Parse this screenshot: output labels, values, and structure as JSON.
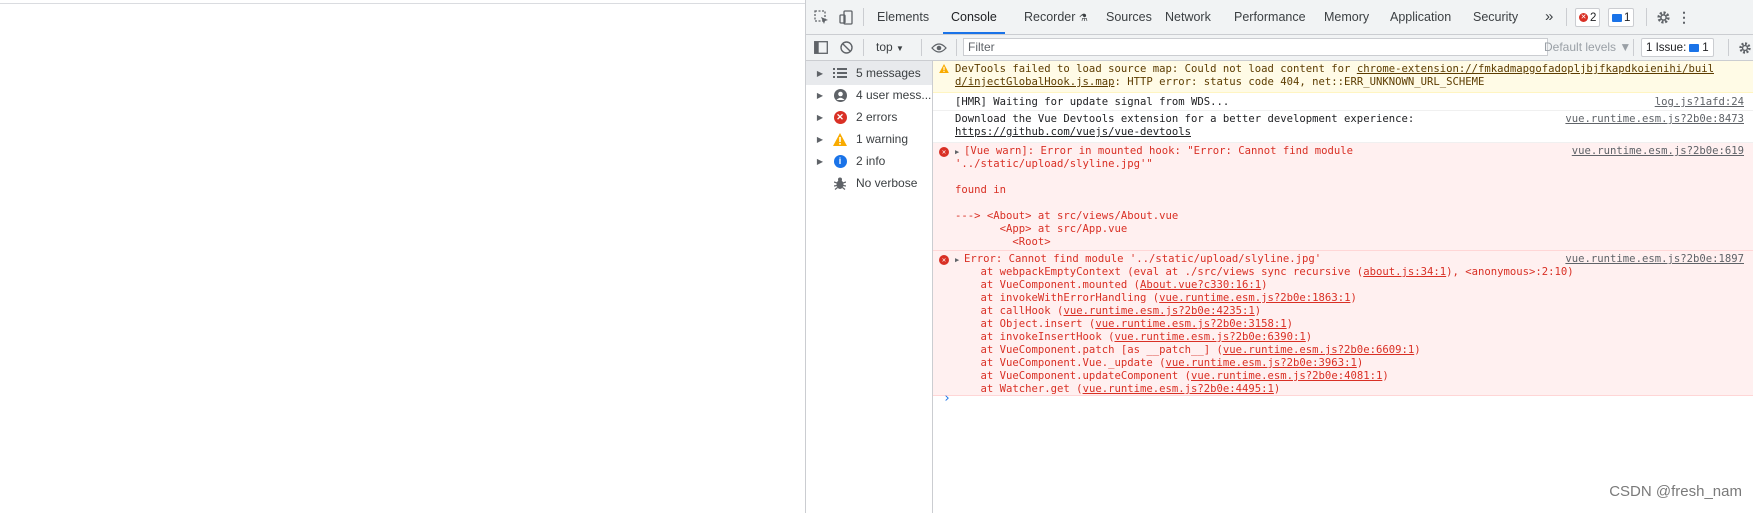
{
  "tabs": [
    "Elements",
    "Console",
    "Recorder",
    "Sources",
    "Network",
    "Performance",
    "Memory",
    "Application",
    "Security"
  ],
  "active_tab": "Console",
  "more_tabs": "»",
  "error_count": "2",
  "message_count": "1",
  "toolbar": {
    "context": "top",
    "context_caret": "▼",
    "filter_placeholder": "Filter",
    "levels": "Default levels ▼",
    "issues_label": "1 Issue:",
    "issues_count": "1"
  },
  "sidebar": [
    {
      "label": "5 messages",
      "icon": "list-icon"
    },
    {
      "label": "4 user mess...",
      "icon": "user-icon"
    },
    {
      "label": "2 errors",
      "icon": "error-icon"
    },
    {
      "label": "1 warning",
      "icon": "warning-icon"
    },
    {
      "label": "2 info",
      "icon": "info-icon"
    },
    {
      "label": "No verbose",
      "icon": "bug-icon"
    }
  ],
  "messages": {
    "warning": {
      "text1": "DevTools failed to load source map: Could not load content for ",
      "link1": "chrome-extension://fmkadmapgofadopljbjfkapdkoienihi/buil",
      "link2": "d/injectGlobalHook.js.map",
      "text2": ": HTTP error: status code 404, net::ERR_UNKNOWN_URL_SCHEME"
    },
    "hmr": {
      "text": "[HMR] Waiting for update signal from WDS...",
      "src": "log.js?1afd:24"
    },
    "devtools": {
      "text": "Download the Vue Devtools extension for a better development experience:",
      "link": "https://github.com/vuejs/vue-devtools",
      "src": "vue.runtime.esm.js?2b0e:8473"
    },
    "vue_warn": {
      "src": "vue.runtime.esm.js?2b0e:619",
      "line1": "[Vue warn]: Error in mounted hook: \"Error: Cannot find module",
      "line2": "'../static/upload/slyline.jpg'\"",
      "line3": "found in",
      "line4": "---> <About> at src/views/About.vue",
      "line5": "       <App> at src/App.vue",
      "line6": "         <Root>"
    },
    "error": {
      "src": "vue.runtime.esm.js?2b0e:1897",
      "head": "Error: Cannot find module '../static/upload/slyline.jpg'",
      "stack": [
        {
          "pre": "    at webpackEmptyContext (eval at ./src/views sync recursive (",
          "link": "about.js:34:1",
          "post": "), <anonymous>:2:10)"
        },
        {
          "pre": "    at VueComponent.mounted (",
          "link": "About.vue?c330:16:1",
          "post": ")"
        },
        {
          "pre": "    at invokeWithErrorHandling (",
          "link": "vue.runtime.esm.js?2b0e:1863:1",
          "post": ")"
        },
        {
          "pre": "    at callHook (",
          "link": "vue.runtime.esm.js?2b0e:4235:1",
          "post": ")"
        },
        {
          "pre": "    at Object.insert (",
          "link": "vue.runtime.esm.js?2b0e:3158:1",
          "post": ")"
        },
        {
          "pre": "    at invokeInsertHook (",
          "link": "vue.runtime.esm.js?2b0e:6390:1",
          "post": ")"
        },
        {
          "pre": "    at VueComponent.patch [as __patch__] (",
          "link": "vue.runtime.esm.js?2b0e:6609:1",
          "post": ")"
        },
        {
          "pre": "    at VueComponent.Vue._update (",
          "link": "vue.runtime.esm.js?2b0e:3963:1",
          "post": ")"
        },
        {
          "pre": "    at VueComponent.updateComponent (",
          "link": "vue.runtime.esm.js?2b0e:4081:1",
          "post": ")"
        },
        {
          "pre": "    at Watcher.get (",
          "link": "vue.runtime.esm.js?2b0e:4495:1",
          "post": ")"
        }
      ]
    }
  },
  "prompt": "›",
  "watermark": "CSDN @fresh_nam",
  "colors": {
    "accent": "#1a73e8",
    "error": "#d93025",
    "warning": "#f9ab00"
  }
}
